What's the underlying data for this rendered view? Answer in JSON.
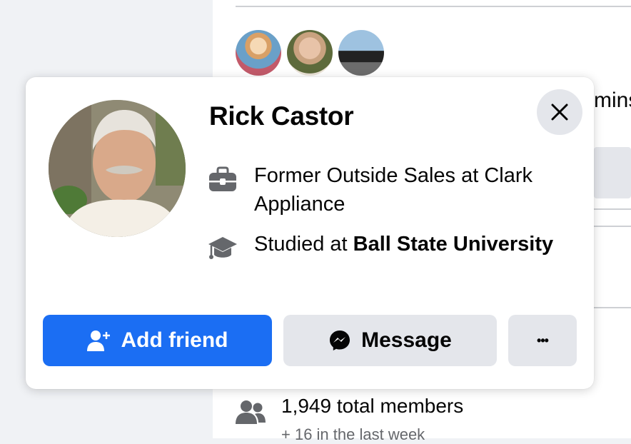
{
  "background": {
    "partial_text": "mins",
    "members": {
      "count_text": "1,949 total members",
      "sub_text": "+ 16 in the last week"
    }
  },
  "card": {
    "name": "Rick Castor",
    "work_text": "Former Outside Sales at Clark Appliance",
    "education_prefix": "Studied at ",
    "education_school": "Ball State University",
    "buttons": {
      "add_friend": "Add friend",
      "message": "Message",
      "more": "•••"
    }
  },
  "icons": {
    "close": "close-icon",
    "work": "briefcase-icon",
    "education": "graduation-cap-icon",
    "add_friend": "add-person-icon",
    "message": "messenger-icon",
    "members": "group-icon"
  },
  "colors": {
    "primary": "#1b6ef3",
    "secondary_button": "#e4e6eb",
    "page_background": "#f0f2f5",
    "icon_gray": "#65676b"
  }
}
